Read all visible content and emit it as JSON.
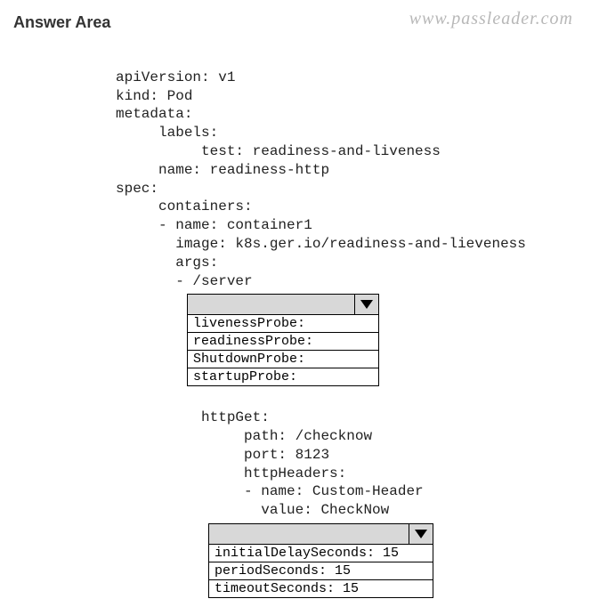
{
  "title": "Answer Area",
  "watermark": "www.passleader.com",
  "yaml": {
    "line1": "apiVersion: v1",
    "line2": "kind: Pod",
    "line3": "metadata:",
    "line4": "     labels:",
    "line5": "          test: readiness-and-liveness",
    "line6": "     name: readiness-http",
    "line7": "spec:",
    "line8": "     containers:",
    "line9": "     - name: container1",
    "line10": "       image: k8s.ger.io/readiness-and-lieveness",
    "line11": "       args:",
    "line12": "       - /server",
    "httpget1": "          httpGet:",
    "httpget2": "               path: /checknow",
    "httpget3": "               port: 8123",
    "httpget4": "               httpHeaders:",
    "httpget5": "               - name: Custom-Header",
    "httpget6": "                 value: CheckNow"
  },
  "dropdown1": {
    "options": [
      "livenessProbe:",
      "readinessProbe:",
      "ShutdownProbe:",
      "startupProbe:"
    ]
  },
  "dropdown2": {
    "options": [
      "initialDelaySeconds: 15",
      "periodSeconds: 15",
      "timeoutSeconds: 15"
    ]
  }
}
